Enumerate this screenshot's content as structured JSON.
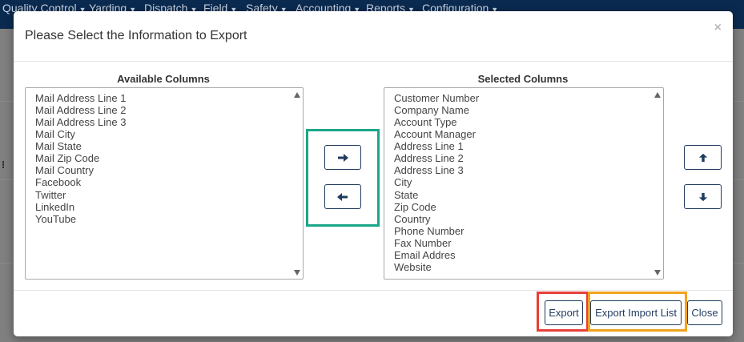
{
  "navbar": {
    "items": [
      {
        "label": "Quality Control"
      },
      {
        "label": "Yarding"
      },
      {
        "label": "Dispatch"
      },
      {
        "label": "Field"
      },
      {
        "label": "Safety"
      },
      {
        "label": "Accounting"
      },
      {
        "label": "Reports"
      },
      {
        "label": "Configuration"
      }
    ]
  },
  "modal": {
    "title": "Please Select the Information to Export",
    "close_label": "×",
    "available": {
      "label": "Available Columns",
      "items": [
        "Mail Address Line 1",
        "Mail Address Line 2",
        "Mail Address Line 3",
        "Mail City",
        "Mail State",
        "Mail Zip Code",
        "Mail Country",
        "Facebook",
        "Twitter",
        "LinkedIn",
        "YouTube"
      ]
    },
    "selected": {
      "label": "Selected Columns",
      "items": [
        "Customer Number",
        "Company Name",
        "Account Type",
        "Account Manager",
        "Address Line 1",
        "Address Line 2",
        "Address Line 3",
        "City",
        "State",
        "Zip Code",
        "Country",
        "Phone Number",
        "Fax Number",
        "Email Addres",
        "Website"
      ]
    },
    "buttons": {
      "export": "Export",
      "export_import_list": "Export Import List",
      "close": "Close"
    }
  },
  "colors": {
    "navbar": "#0b2a50",
    "highlight_transfer": "#1aa688",
    "highlight_export": "#e8403a",
    "highlight_import_list": "#f1a31e",
    "button_border": "#1f3b5e"
  },
  "icons": [
    "caret-down-icon",
    "close-icon",
    "arrow-right-icon",
    "arrow-left-icon",
    "arrow-up-icon",
    "arrow-down-icon",
    "scroll-up-icon",
    "scroll-down-icon"
  ]
}
